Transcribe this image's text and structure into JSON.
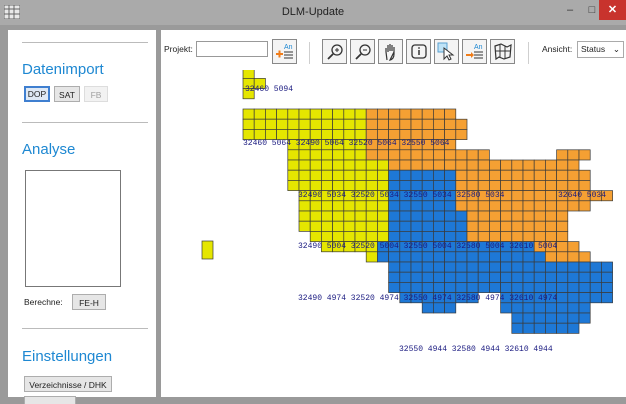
{
  "window": {
    "title": "DLM-Update",
    "minimize_glyph": "–",
    "maximize_glyph": "□",
    "close_glyph": "✕"
  },
  "sidebar": {
    "datenimport": {
      "title": "Datenimport",
      "buttons": [
        "DOP",
        "SAT",
        "FB"
      ],
      "active": "DOP",
      "disabled": "FB"
    },
    "analyse": {
      "title": "Analyse",
      "berechne_label": "Berechne:",
      "berechne_button": "FE-H"
    },
    "einstellungen": {
      "title": "Einstellungen",
      "verzeichnisse_button": "Verzeichnisse / DHK"
    }
  },
  "toolbar": {
    "projekt_label": "Projekt:",
    "projekt_value": "",
    "ansicht_label": "Ansicht:",
    "ansicht_value": "Status",
    "tools": [
      "add-layer-icon",
      "zoom-in-icon",
      "zoom-out-icon",
      "pan-hand-icon",
      "info-icon",
      "select-arrow-icon",
      "import-layer-icon",
      "grid-map-icon"
    ]
  },
  "colors": {
    "yellow": "#e5e600",
    "orange": "#f5a033",
    "blue": "#1e78d6",
    "label_dark": "#1a1a80",
    "accent": "#1e88d2",
    "close": "#c8332d"
  },
  "map": {
    "labels": [
      {
        "text": "32460 5094"
      },
      {
        "text": "32460 5064 32490 5064 32520 5064 32550 5064"
      },
      {
        "text": "32490 5034 32520 5034 32550 5034 32580 5034"
      },
      {
        "text": "32640 5034"
      },
      {
        "text": "32490 5004 32520 5004 32550 5004 32580 5004 32610 5004"
      },
      {
        "text": "32490 4974 32520 4974 32550 4974 32580 4974 32610 4974"
      },
      {
        "text": "32550 4944 32580 4944 32610 4944"
      }
    ]
  }
}
